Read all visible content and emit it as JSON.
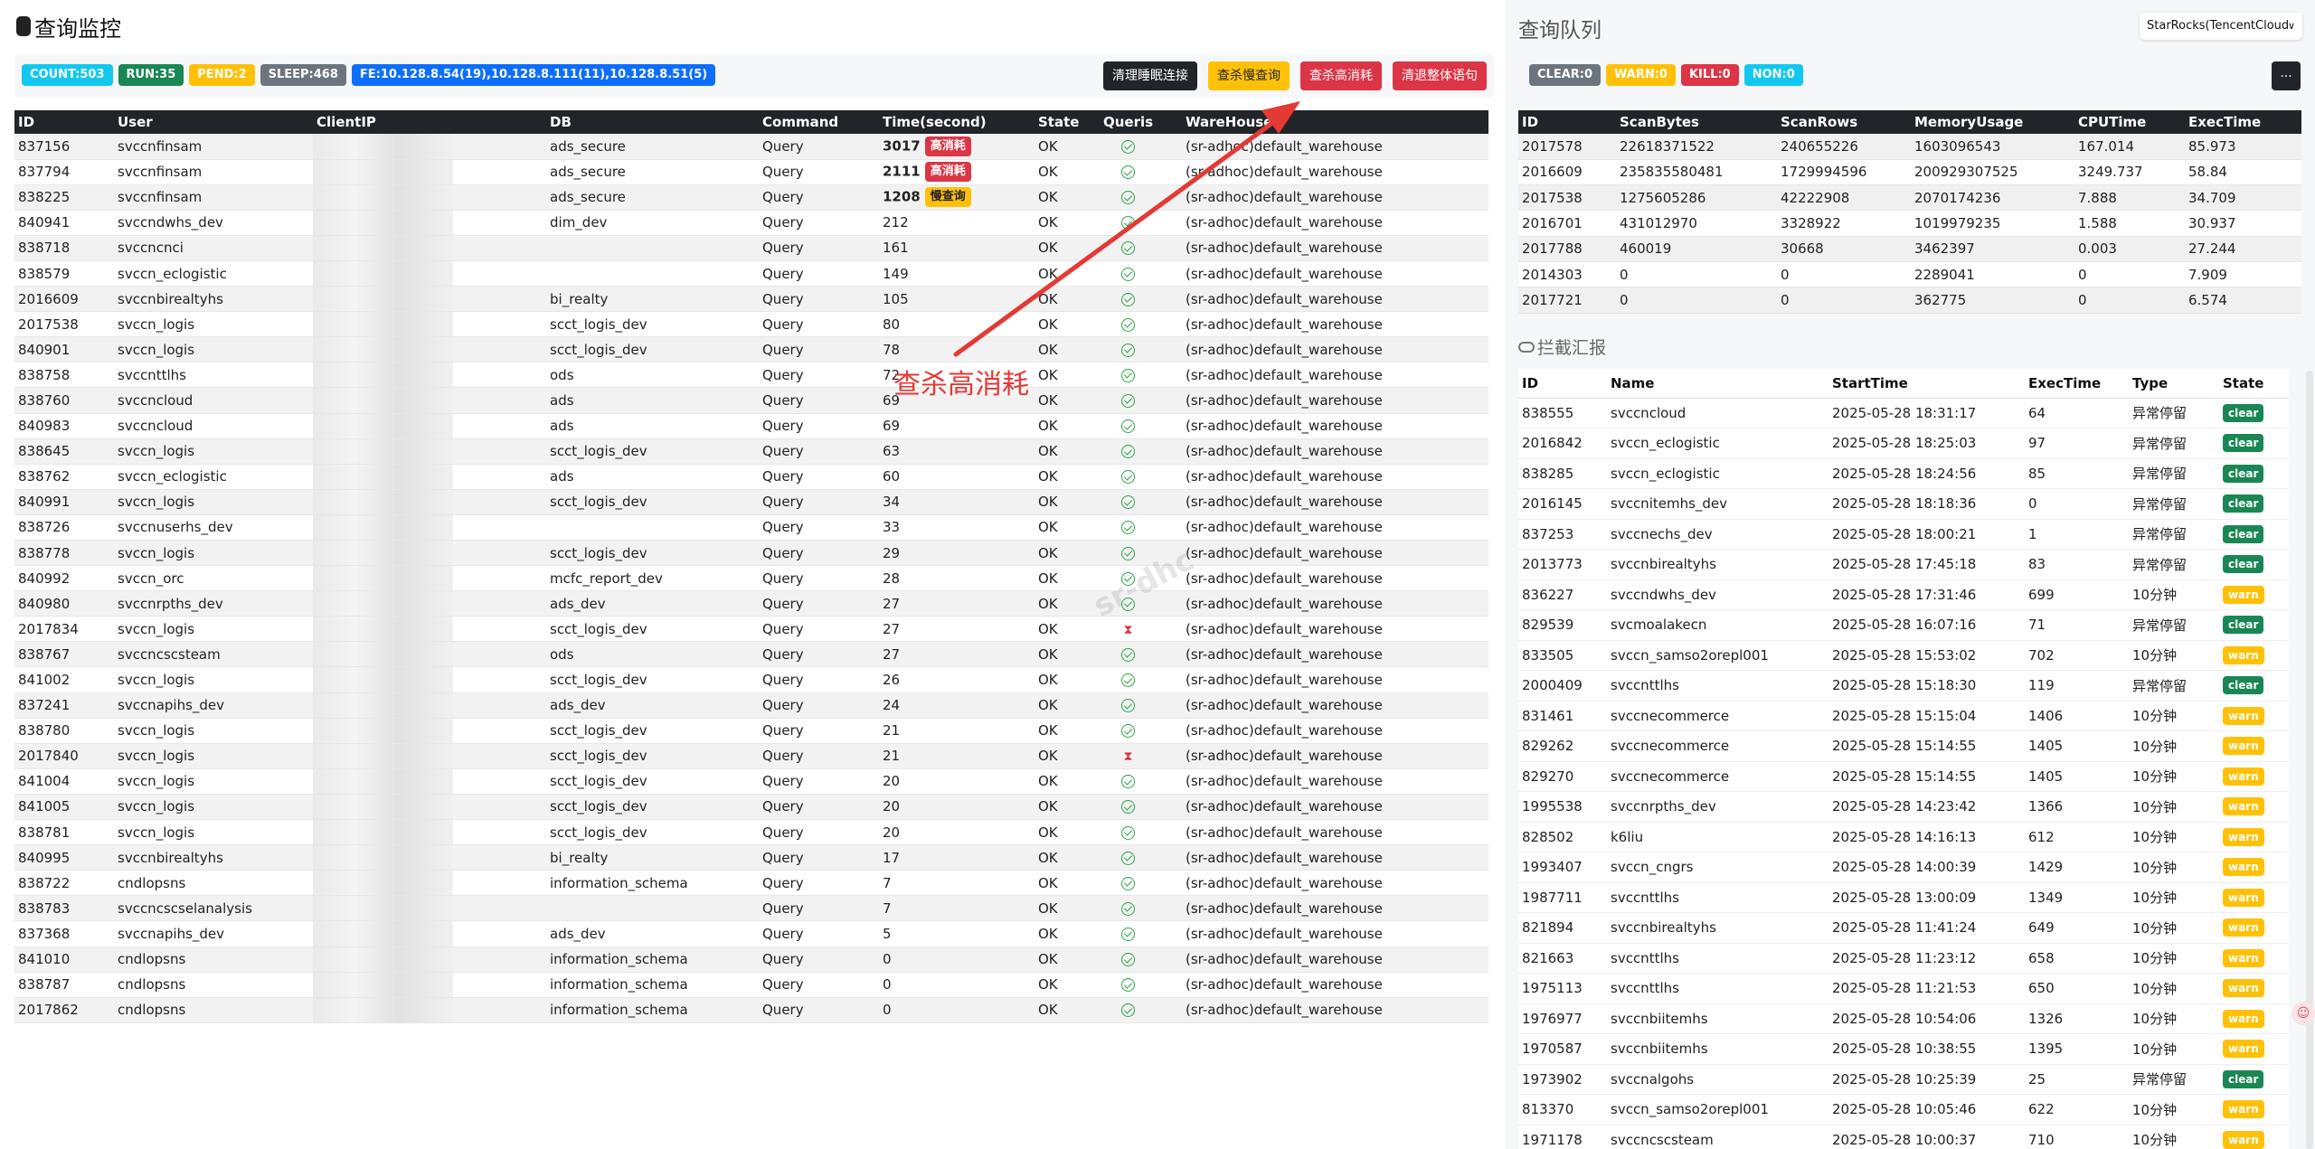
{
  "left": {
    "title": "查询监控",
    "badges": [
      "COUNT:503",
      "RUN:35",
      "PEND:2",
      "SLEEP:468",
      "FE:10.128.8.54(19),10.128.8.111(11),10.128.8.51(5)"
    ],
    "actions": [
      "清理睡眠连接",
      "查杀慢查询",
      "查杀高消耗",
      "清退整体语句"
    ],
    "columns": [
      "ID",
      "User",
      "ClientIP",
      "DB",
      "Command",
      "Time(second)",
      "State",
      "Queris",
      "WareHouse"
    ],
    "tag_high": "高消耗",
    "tag_slow": "慢查询",
    "annotation": "查杀高消耗",
    "watermark": "sr-dhc",
    "rows": [
      {
        "id": "837156",
        "user": "svccnfinsam",
        "db": "ads_secure",
        "cmd": "Query",
        "time": "3017",
        "tag": "high",
        "state": "OK",
        "q": "ok",
        "wh": "(sr-adhoc)default_warehouse"
      },
      {
        "id": "837794",
        "user": "svccnfinsam",
        "db": "ads_secure",
        "cmd": "Query",
        "time": "2111",
        "tag": "high",
        "state": "OK",
        "q": "ok",
        "wh": "(sr-adhoc)default_warehouse"
      },
      {
        "id": "838225",
        "user": "svccnfinsam",
        "db": "ads_secure",
        "cmd": "Query",
        "time": "1208",
        "tag": "slow",
        "state": "OK",
        "q": "ok",
        "wh": "(sr-adhoc)default_warehouse"
      },
      {
        "id": "840941",
        "user": "svccndwhs_dev",
        "db": "dim_dev",
        "cmd": "Query",
        "time": "212",
        "tag": "",
        "state": "OK",
        "q": "ok",
        "wh": "(sr-adhoc)default_warehouse"
      },
      {
        "id": "838718",
        "user": "svccncnci",
        "db": "",
        "cmd": "Query",
        "time": "161",
        "tag": "",
        "state": "OK",
        "q": "ok",
        "wh": "(sr-adhoc)default_warehouse"
      },
      {
        "id": "838579",
        "user": "svccn_eclogistic",
        "db": "",
        "cmd": "Query",
        "time": "149",
        "tag": "",
        "state": "OK",
        "q": "ok",
        "wh": "(sr-adhoc)default_warehouse"
      },
      {
        "id": "2016609",
        "user": "svccnbirealtyhs",
        "db": "bi_realty",
        "cmd": "Query",
        "time": "105",
        "tag": "",
        "state": "OK",
        "q": "ok",
        "wh": "(sr-adhoc)default_warehouse"
      },
      {
        "id": "2017538",
        "user": "svccn_logis",
        "db": "scct_logis_dev",
        "cmd": "Query",
        "time": "80",
        "tag": "",
        "state": "OK",
        "q": "ok",
        "wh": "(sr-adhoc)default_warehouse"
      },
      {
        "id": "840901",
        "user": "svccn_logis",
        "db": "scct_logis_dev",
        "cmd": "Query",
        "time": "78",
        "tag": "",
        "state": "OK",
        "q": "ok",
        "wh": "(sr-adhoc)default_warehouse"
      },
      {
        "id": "838758",
        "user": "svccnttlhs",
        "db": "ods",
        "cmd": "Query",
        "time": "72",
        "tag": "",
        "state": "OK",
        "q": "ok",
        "wh": "(sr-adhoc)default_warehouse"
      },
      {
        "id": "838760",
        "user": "svccncloud",
        "db": "ads",
        "cmd": "Query",
        "time": "69",
        "tag": "",
        "state": "OK",
        "q": "ok",
        "wh": "(sr-adhoc)default_warehouse"
      },
      {
        "id": "840983",
        "user": "svccncloud",
        "db": "ads",
        "cmd": "Query",
        "time": "69",
        "tag": "",
        "state": "OK",
        "q": "ok",
        "wh": "(sr-adhoc)default_warehouse"
      },
      {
        "id": "838645",
        "user": "svccn_logis",
        "db": "scct_logis_dev",
        "cmd": "Query",
        "time": "63",
        "tag": "",
        "state": "OK",
        "q": "ok",
        "wh": "(sr-adhoc)default_warehouse"
      },
      {
        "id": "838762",
        "user": "svccn_eclogistic",
        "db": "ads",
        "cmd": "Query",
        "time": "60",
        "tag": "",
        "state": "OK",
        "q": "ok",
        "wh": "(sr-adhoc)default_warehouse"
      },
      {
        "id": "840991",
        "user": "svccn_logis",
        "db": "scct_logis_dev",
        "cmd": "Query",
        "time": "34",
        "tag": "",
        "state": "OK",
        "q": "ok",
        "wh": "(sr-adhoc)default_warehouse"
      },
      {
        "id": "838726",
        "user": "svccnuserhs_dev",
        "db": "",
        "cmd": "Query",
        "time": "33",
        "tag": "",
        "state": "OK",
        "q": "ok",
        "wh": "(sr-adhoc)default_warehouse"
      },
      {
        "id": "838778",
        "user": "svccn_logis",
        "db": "scct_logis_dev",
        "cmd": "Query",
        "time": "29",
        "tag": "",
        "state": "OK",
        "q": "ok",
        "wh": "(sr-adhoc)default_warehouse"
      },
      {
        "id": "840992",
        "user": "svccn_orc",
        "db": "mcfc_report_dev",
        "cmd": "Query",
        "time": "28",
        "tag": "",
        "state": "OK",
        "q": "ok",
        "wh": "(sr-adhoc)default_warehouse"
      },
      {
        "id": "840980",
        "user": "svccnrpths_dev",
        "db": "ads_dev",
        "cmd": "Query",
        "time": "27",
        "tag": "",
        "state": "OK",
        "q": "ok",
        "wh": "(sr-adhoc)default_warehouse"
      },
      {
        "id": "2017834",
        "user": "svccn_logis",
        "db": "scct_logis_dev",
        "cmd": "Query",
        "time": "27",
        "tag": "",
        "state": "OK",
        "q": "wait",
        "wh": "(sr-adhoc)default_warehouse"
      },
      {
        "id": "838767",
        "user": "svccncscsteam",
        "db": "ods",
        "cmd": "Query",
        "time": "27",
        "tag": "",
        "state": "OK",
        "q": "ok",
        "wh": "(sr-adhoc)default_warehouse"
      },
      {
        "id": "841002",
        "user": "svccn_logis",
        "db": "scct_logis_dev",
        "cmd": "Query",
        "time": "26",
        "tag": "",
        "state": "OK",
        "q": "ok",
        "wh": "(sr-adhoc)default_warehouse"
      },
      {
        "id": "837241",
        "user": "svccnapihs_dev",
        "db": "ads_dev",
        "cmd": "Query",
        "time": "24",
        "tag": "",
        "state": "OK",
        "q": "ok",
        "wh": "(sr-adhoc)default_warehouse"
      },
      {
        "id": "838780",
        "user": "svccn_logis",
        "db": "scct_logis_dev",
        "cmd": "Query",
        "time": "21",
        "tag": "",
        "state": "OK",
        "q": "ok",
        "wh": "(sr-adhoc)default_warehouse"
      },
      {
        "id": "2017840",
        "user": "svccn_logis",
        "db": "scct_logis_dev",
        "cmd": "Query",
        "time": "21",
        "tag": "",
        "state": "OK",
        "q": "wait",
        "wh": "(sr-adhoc)default_warehouse"
      },
      {
        "id": "841004",
        "user": "svccn_logis",
        "db": "scct_logis_dev",
        "cmd": "Query",
        "time": "20",
        "tag": "",
        "state": "OK",
        "q": "ok",
        "wh": "(sr-adhoc)default_warehouse"
      },
      {
        "id": "841005",
        "user": "svccn_logis",
        "db": "scct_logis_dev",
        "cmd": "Query",
        "time": "20",
        "tag": "",
        "state": "OK",
        "q": "ok",
        "wh": "(sr-adhoc)default_warehouse"
      },
      {
        "id": "838781",
        "user": "svccn_logis",
        "db": "scct_logis_dev",
        "cmd": "Query",
        "time": "20",
        "tag": "",
        "state": "OK",
        "q": "ok",
        "wh": "(sr-adhoc)default_warehouse"
      },
      {
        "id": "840995",
        "user": "svccnbirealtyhs",
        "db": "bi_realty",
        "cmd": "Query",
        "time": "17",
        "tag": "",
        "state": "OK",
        "q": "ok",
        "wh": "(sr-adhoc)default_warehouse"
      },
      {
        "id": "838722",
        "user": "cndlopsns",
        "db": "information_schema",
        "cmd": "Query",
        "time": "7",
        "tag": "",
        "state": "OK",
        "q": "ok",
        "wh": "(sr-adhoc)default_warehouse"
      },
      {
        "id": "838783",
        "user": "svccncscselanalysis",
        "db": "",
        "cmd": "Query",
        "time": "7",
        "tag": "",
        "state": "OK",
        "q": "ok",
        "wh": "(sr-adhoc)default_warehouse"
      },
      {
        "id": "837368",
        "user": "svccnapihs_dev",
        "db": "ads_dev",
        "cmd": "Query",
        "time": "5",
        "tag": "",
        "state": "OK",
        "q": "ok",
        "wh": "(sr-adhoc)default_warehouse"
      },
      {
        "id": "841010",
        "user": "cndlopsns",
        "db": "information_schema",
        "cmd": "Query",
        "time": "0",
        "tag": "",
        "state": "OK",
        "q": "ok",
        "wh": "(sr-adhoc)default_warehouse"
      },
      {
        "id": "838787",
        "user": "cndlopsns",
        "db": "information_schema",
        "cmd": "Query",
        "time": "0",
        "tag": "",
        "state": "OK",
        "q": "ok",
        "wh": "(sr-adhoc)default_warehouse"
      },
      {
        "id": "2017862",
        "user": "cndlopsns",
        "db": "information_schema",
        "cmd": "Query",
        "time": "0",
        "tag": "",
        "state": "OK",
        "q": "ok",
        "wh": "(sr-adhoc)default_warehouse"
      }
    ]
  },
  "right": {
    "title": "查询队列",
    "engine": "StarRocks(TencentCloud",
    "badges": [
      "CLEAR:0",
      "WARN:0",
      "KILL:0",
      "NON:0"
    ],
    "more": "...",
    "queue_columns": [
      "ID",
      "ScanBytes",
      "ScanRows",
      "MemoryUsage",
      "CPUTime",
      "ExecTime"
    ],
    "queue_rows": [
      [
        "2017578",
        "22618371522",
        "240655226",
        "1603096543",
        "167.014",
        "85.973"
      ],
      [
        "2016609",
        "235835580481",
        "1729994596",
        "200929307525",
        "3249.737",
        "58.84"
      ],
      [
        "2017538",
        "1275605286",
        "42222908",
        "2070174236",
        "7.888",
        "34.709"
      ],
      [
        "2016701",
        "431012970",
        "3328922",
        "1019979235",
        "1.588",
        "30.937"
      ],
      [
        "2017788",
        "460019",
        "30668",
        "3462397",
        "0.003",
        "27.244"
      ],
      [
        "2014303",
        "0",
        "0",
        "2289041",
        "0",
        "7.909"
      ],
      [
        "2017721",
        "0",
        "0",
        "362775",
        "0",
        "6.574"
      ]
    ],
    "intercept_title": "拦截汇报",
    "intercept_columns": [
      "ID",
      "Name",
      "StartTime",
      "ExecTime",
      "Type",
      "State"
    ],
    "intercept_rows": [
      [
        "838555",
        "svccncloud",
        "2025-05-28 18:31:17",
        "64",
        "异常停留",
        "clear"
      ],
      [
        "2016842",
        "svccn_eclogistic",
        "2025-05-28 18:25:03",
        "97",
        "异常停留",
        "clear"
      ],
      [
        "838285",
        "svccn_eclogistic",
        "2025-05-28 18:24:56",
        "85",
        "异常停留",
        "clear"
      ],
      [
        "2016145",
        "svccnitemhs_dev",
        "2025-05-28 18:18:36",
        "0",
        "异常停留",
        "clear"
      ],
      [
        "837253",
        "svccnechs_dev",
        "2025-05-28 18:00:21",
        "1",
        "异常停留",
        "clear"
      ],
      [
        "2013773",
        "svccnbirealtyhs",
        "2025-05-28 17:45:18",
        "83",
        "异常停留",
        "clear"
      ],
      [
        "836227",
        "svccndwhs_dev",
        "2025-05-28 17:31:46",
        "699",
        "10分钟",
        "warn"
      ],
      [
        "829539",
        "svcmoalakecn",
        "2025-05-28 16:07:16",
        "71",
        "异常停留",
        "clear"
      ],
      [
        "833505",
        "svccn_samso2orepl001",
        "2025-05-28 15:53:02",
        "702",
        "10分钟",
        "warn"
      ],
      [
        "2000409",
        "svccnttlhs",
        "2025-05-28 15:18:30",
        "119",
        "异常停留",
        "clear"
      ],
      [
        "831461",
        "svccnecommerce",
        "2025-05-28 15:15:04",
        "1406",
        "10分钟",
        "warn"
      ],
      [
        "829262",
        "svccnecommerce",
        "2025-05-28 15:14:55",
        "1405",
        "10分钟",
        "warn"
      ],
      [
        "829270",
        "svccnecommerce",
        "2025-05-28 15:14:55",
        "1405",
        "10分钟",
        "warn"
      ],
      [
        "1995538",
        "svccnrpths_dev",
        "2025-05-28 14:23:42",
        "1366",
        "10分钟",
        "warn"
      ],
      [
        "828502",
        "k6liu",
        "2025-05-28 14:16:13",
        "612",
        "10分钟",
        "warn"
      ],
      [
        "1993407",
        "svccn_cngrs",
        "2025-05-28 14:00:39",
        "1429",
        "10分钟",
        "warn"
      ],
      [
        "1987711",
        "svccnttlhs",
        "2025-05-28 13:00:09",
        "1349",
        "10分钟",
        "warn"
      ],
      [
        "821894",
        "svccnbirealtyhs",
        "2025-05-28 11:41:24",
        "649",
        "10分钟",
        "warn"
      ],
      [
        "821663",
        "svccnttlhs",
        "2025-05-28 11:23:12",
        "658",
        "10分钟",
        "warn"
      ],
      [
        "1975113",
        "svccnttlhs",
        "2025-05-28 11:21:53",
        "650",
        "10分钟",
        "warn"
      ],
      [
        "1976977",
        "svccnbiitemhs",
        "2025-05-28 10:54:06",
        "1326",
        "10分钟",
        "warn"
      ],
      [
        "1970587",
        "svccnbiitemhs",
        "2025-05-28 10:38:55",
        "1395",
        "10分钟",
        "warn"
      ],
      [
        "1973902",
        "svccnalgohs",
        "2025-05-28 10:25:39",
        "25",
        "异常停留",
        "clear"
      ],
      [
        "813370",
        "svccn_samso2orepl001",
        "2025-05-28 10:05:46",
        "622",
        "10分钟",
        "warn"
      ],
      [
        "1971178",
        "svccncscsteam",
        "2025-05-28 10:00:37",
        "710",
        "10分钟",
        "warn"
      ]
    ]
  }
}
